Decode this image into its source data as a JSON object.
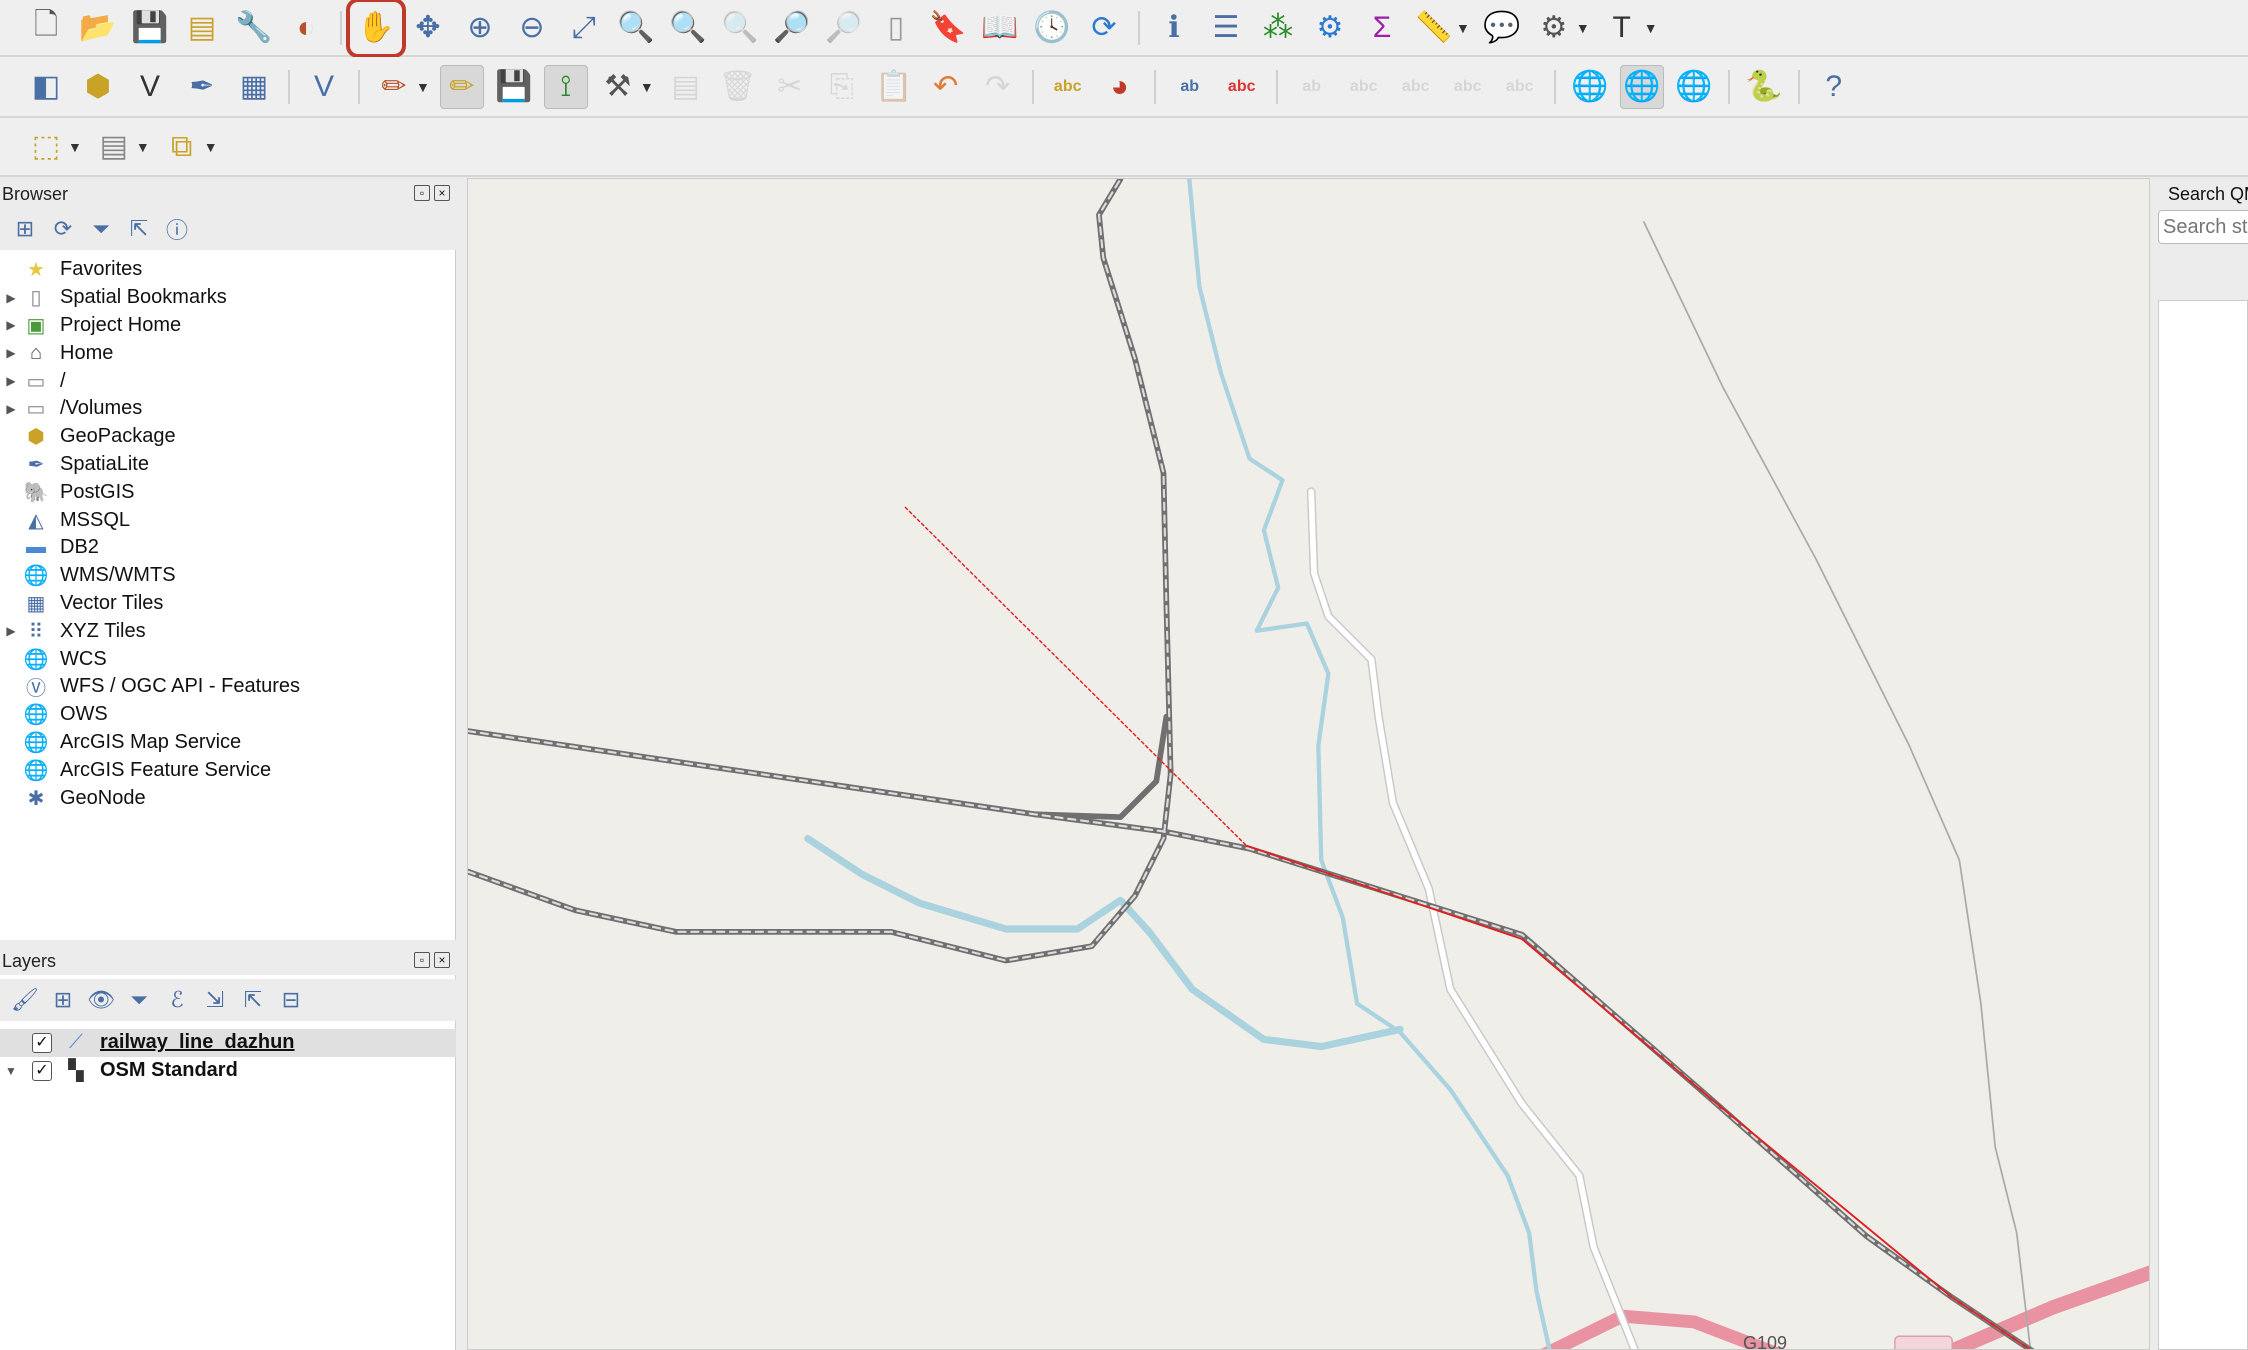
{
  "toolbar1": [
    {
      "name": "new-project-icon",
      "g": "🗋",
      "c": "#555"
    },
    {
      "name": "open-project-icon",
      "g": "📂",
      "c": "#e8b84a"
    },
    {
      "name": "save-project-icon",
      "g": "💾",
      "c": "#4a6fa5"
    },
    {
      "name": "new-print-layout-icon",
      "g": "▤",
      "c": "#c9a227"
    },
    {
      "name": "layout-manager-icon",
      "g": "🔧",
      "c": "#666"
    },
    {
      "name": "style-manager-icon",
      "g": "◐",
      "c": "#b5532c"
    },
    {
      "sep": true
    },
    {
      "name": "pan-map-icon",
      "g": "✋",
      "c": "#222",
      "hl": true
    },
    {
      "name": "pan-to-selection-icon",
      "g": "✥",
      "c": "#4a6fa5"
    },
    {
      "name": "zoom-in-icon",
      "g": "⊕",
      "c": "#4a6fa5"
    },
    {
      "name": "zoom-out-icon",
      "g": "⊖",
      "c": "#4a6fa5"
    },
    {
      "name": "zoom-full-icon",
      "g": "⤢",
      "c": "#4a6fa5"
    },
    {
      "name": "zoom-to-selection-icon",
      "g": "🔍",
      "c": "#c9a227"
    },
    {
      "name": "zoom-to-layer-icon",
      "g": "🔍",
      "c": "#666"
    },
    {
      "name": "zoom-native-icon",
      "g": "🔍",
      "c": "#aaa",
      "dis": true
    },
    {
      "name": "zoom-last-icon",
      "g": "🔎",
      "c": "#4a6fa5"
    },
    {
      "name": "zoom-next-icon",
      "g": "🔎",
      "c": "#aaa",
      "dis": true
    },
    {
      "name": "new-map-view-icon",
      "g": "▯",
      "c": "#999"
    },
    {
      "name": "new-bookmark-icon",
      "g": "🔖",
      "c": "#4a6fa5"
    },
    {
      "name": "show-bookmarks-icon",
      "g": "📖",
      "c": "#666"
    },
    {
      "name": "temporal-controller-icon",
      "g": "🕓",
      "c": "#444"
    },
    {
      "name": "refresh-icon",
      "g": "⟳",
      "c": "#2c7bd1"
    },
    {
      "sep": true
    },
    {
      "name": "identify-features-icon",
      "g": "ℹ",
      "c": "#4a6fa5"
    },
    {
      "name": "attribute-table-icon",
      "g": "☰",
      "c": "#4a6fa5"
    },
    {
      "name": "field-calculator-icon",
      "g": "⁂",
      "c": "#2a8a2a"
    },
    {
      "name": "processing-toolbox-icon",
      "g": "⚙",
      "c": "#2c7bd1"
    },
    {
      "name": "statistical-summary-icon",
      "g": "Σ",
      "c": "#9b1fa8"
    },
    {
      "name": "measure-icon",
      "g": "📏",
      "c": "#555",
      "dd": true
    },
    {
      "name": "map-tips-icon",
      "g": "💬",
      "c": "#e8d24a"
    },
    {
      "name": "run-action-icon",
      "g": "⚙",
      "c": "#555",
      "dd": true
    },
    {
      "name": "text-annotation-icon",
      "g": "T",
      "c": "#333",
      "dd": true
    }
  ],
  "toolbar2": [
    {
      "name": "data-source-manager-icon",
      "g": "◧",
      "c": "#4a6fa5"
    },
    {
      "name": "new-geopackage-layer-icon",
      "g": "⬢",
      "c": "#c9a227"
    },
    {
      "name": "new-shapefile-layer-icon",
      "g": "V",
      "c": "#333"
    },
    {
      "name": "new-spatialite-layer-icon",
      "g": "✒",
      "c": "#4a6fa5"
    },
    {
      "name": "new-temporary-layer-icon",
      "g": "▦",
      "c": "#4a6fa5"
    },
    {
      "sep": true
    },
    {
      "name": "new-virtual-layer-icon",
      "g": "V",
      "c": "#4a6fa5"
    },
    {
      "sep": true
    },
    {
      "name": "current-edits-icon",
      "g": "✏",
      "c": "#b5532c",
      "dd": true
    },
    {
      "name": "toggle-editing-icon",
      "g": "✏",
      "c": "#c9a227",
      "act": true
    },
    {
      "name": "save-edits-icon",
      "g": "💾",
      "c": "#4a6fa5"
    },
    {
      "name": "digitize-icon",
      "g": "⟟",
      "c": "#2a8a2a",
      "act": true
    },
    {
      "name": "vertex-tool-icon",
      "g": "⚒",
      "c": "#555",
      "dd": true
    },
    {
      "name": "modify-attributes-icon",
      "g": "▤",
      "c": "#aaa",
      "dis": true
    },
    {
      "name": "delete-selected-icon",
      "g": "🗑",
      "c": "#aaa",
      "dis": true
    },
    {
      "name": "cut-features-icon",
      "g": "✂",
      "c": "#aaa",
      "dis": true
    },
    {
      "name": "copy-features-icon",
      "g": "⎘",
      "c": "#aaa",
      "dis": true
    },
    {
      "name": "paste-features-icon",
      "g": "📋",
      "c": "#aaa",
      "dis": true
    },
    {
      "name": "undo-icon",
      "g": "↶",
      "c": "#e07b39"
    },
    {
      "name": "redo-icon",
      "g": "↷",
      "c": "#aaa",
      "dis": true
    },
    {
      "sep": true
    },
    {
      "name": "label-toolbar-icon",
      "g": "abc",
      "c": "#c9a227"
    },
    {
      "name": "diagram-options-icon",
      "g": "◕",
      "c": "#c0392b"
    },
    {
      "sep": true
    },
    {
      "name": "pin-labels-icon",
      "g": "ab",
      "c": "#4a6fa5"
    },
    {
      "name": "highlight-labels-icon",
      "g": "abc",
      "c": "#d33"
    },
    {
      "sep": true
    },
    {
      "name": "move-label-icon",
      "g": "ab",
      "c": "#aaa",
      "dis": true
    },
    {
      "name": "show-hide-labels-icon",
      "g": "abc",
      "c": "#aaa",
      "dis": true
    },
    {
      "name": "move-label-arrow-icon",
      "g": "abc",
      "c": "#aaa",
      "dis": true
    },
    {
      "name": "rotate-label-icon",
      "g": "abc",
      "c": "#aaa",
      "dis": true
    },
    {
      "name": "change-label-icon",
      "g": "abc",
      "c": "#aaa",
      "dis": true
    },
    {
      "sep": true
    },
    {
      "name": "metasearch-icon",
      "g": "🌐",
      "c": "#2c7bd1"
    },
    {
      "name": "quickmapservices-icon",
      "g": "🌐",
      "c": "#2c7bd1",
      "act": true
    },
    {
      "name": "search-qms-icon",
      "g": "🌐",
      "c": "#333"
    },
    {
      "sep": true
    },
    {
      "name": "python-console-icon",
      "g": "🐍",
      "c": "#3b74a8"
    },
    {
      "sep": true
    },
    {
      "name": "help-icon",
      "g": "?",
      "c": "#4a6fa5"
    }
  ],
  "toolbar3": [
    {
      "name": "select-features-icon",
      "g": "⬚",
      "c": "#c9a227",
      "dd": true
    },
    {
      "name": "select-by-value-icon",
      "g": "▤",
      "c": "#888",
      "dd": true
    },
    {
      "name": "deselect-features-icon",
      "g": "⧉",
      "c": "#c9a227",
      "dd": true
    }
  ],
  "browser": {
    "title": "Browser",
    "tools": [
      {
        "name": "add-selected-layers-icon",
        "g": "⊞"
      },
      {
        "name": "refresh-icon",
        "g": "⟳"
      },
      {
        "name": "filter-icon",
        "g": "⏷"
      },
      {
        "name": "collapse-all-icon",
        "g": "⇱"
      },
      {
        "name": "properties-icon",
        "g": "ⓘ"
      }
    ],
    "items": [
      {
        "label": "Favorites",
        "icon": "star-icon",
        "g": "★",
        "c": "#e8c840",
        "exp": false
      },
      {
        "label": "Spatial Bookmarks",
        "icon": "bookmark-icon",
        "g": "▯",
        "c": "#888",
        "exp": true
      },
      {
        "label": "Project Home",
        "icon": "project-home-icon",
        "g": "▣",
        "c": "#4a9a3a",
        "exp": true
      },
      {
        "label": "Home",
        "icon": "home-icon",
        "g": "⌂",
        "c": "#555",
        "exp": true
      },
      {
        "label": "/",
        "icon": "folder-icon",
        "g": "▭",
        "c": "#888",
        "exp": true
      },
      {
        "label": "/Volumes",
        "icon": "folder-icon",
        "g": "▭",
        "c": "#888",
        "exp": true
      },
      {
        "label": "GeoPackage",
        "icon": "geopackage-icon",
        "g": "⬢",
        "c": "#c9a227",
        "exp": false
      },
      {
        "label": "SpatiaLite",
        "icon": "spatialite-icon",
        "g": "✒",
        "c": "#4a6fa5",
        "exp": false
      },
      {
        "label": "PostGIS",
        "icon": "postgis-icon",
        "g": "🐘",
        "c": "#4a6fa5",
        "exp": false
      },
      {
        "label": "MSSQL",
        "icon": "mssql-icon",
        "g": "◭",
        "c": "#4a6fa5",
        "exp": false
      },
      {
        "label": "DB2",
        "icon": "db2-icon",
        "g": "▬",
        "c": "#4a8ad0",
        "exp": false
      },
      {
        "label": "WMS/WMTS",
        "icon": "wms-icon",
        "g": "🌐",
        "c": "#4a6fa5",
        "exp": false
      },
      {
        "label": "Vector Tiles",
        "icon": "vector-tiles-icon",
        "g": "▦",
        "c": "#4a6fa5",
        "exp": false
      },
      {
        "label": "XYZ Tiles",
        "icon": "xyz-tiles-icon",
        "g": "⠿",
        "c": "#4a6fa5",
        "exp": true
      },
      {
        "label": "WCS",
        "icon": "wcs-icon",
        "g": "🌐",
        "c": "#333",
        "exp": false
      },
      {
        "label": "WFS / OGC API - Features",
        "icon": "wfs-icon",
        "g": "Ⓥ",
        "c": "#4a6fa5",
        "exp": false
      },
      {
        "label": "OWS",
        "icon": "ows-icon",
        "g": "🌐",
        "c": "#88a",
        "exp": false
      },
      {
        "label": "ArcGIS Map Service",
        "icon": "arcgis-map-icon",
        "g": "🌐",
        "c": "#4a6fa5",
        "exp": false
      },
      {
        "label": "ArcGIS Feature Service",
        "icon": "arcgis-feature-icon",
        "g": "🌐",
        "c": "#4a6fa5",
        "exp": false
      },
      {
        "label": "GeoNode",
        "icon": "geonode-icon",
        "g": "✱",
        "c": "#4a6fa5",
        "exp": false
      }
    ]
  },
  "layers": {
    "title": "Layers",
    "tools": [
      {
        "name": "style-panel-icon",
        "g": "🖌"
      },
      {
        "name": "add-group-icon",
        "g": "⊞"
      },
      {
        "name": "manage-themes-icon",
        "g": "👁"
      },
      {
        "name": "filter-legend-icon",
        "g": "⏷"
      },
      {
        "name": "filter-expression-icon",
        "g": "ℰ"
      },
      {
        "name": "expand-all-icon",
        "g": "⇲"
      },
      {
        "name": "collapse-all-icon",
        "g": "⇱"
      },
      {
        "name": "remove-layer-icon",
        "g": "⊟"
      }
    ],
    "items": [
      {
        "label": "railway_line_dazhun",
        "checked": true,
        "selected": true,
        "icon": "line-layer-icon"
      },
      {
        "label": "OSM Standard",
        "checked": true,
        "selected": false,
        "icon": "raster-layer-icon"
      }
    ]
  },
  "map": {
    "road_label": "G109",
    "colors": {
      "background": "#f0eee9",
      "railway": "#707070",
      "river": "#aad3df",
      "road": "#e892a2",
      "selection": "#e02020"
    }
  },
  "right_panel": {
    "title": "Search QMS",
    "search_placeholder": "Search string..."
  }
}
